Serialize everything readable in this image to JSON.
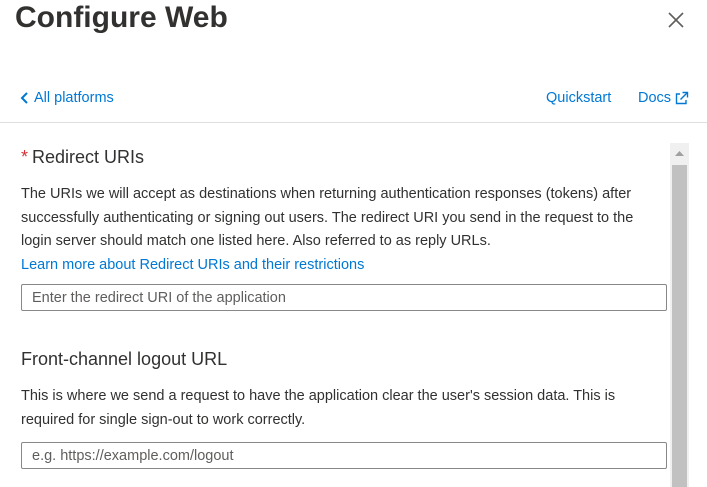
{
  "header": {
    "title": "Configure Web"
  },
  "nav": {
    "back_label": "All platforms",
    "quickstart_label": "Quickstart",
    "docs_label": "Docs"
  },
  "redirect": {
    "required_marker": "*",
    "heading": "Redirect URIs",
    "description": "The URIs we will accept as destinations when returning authentication responses (tokens) after successfully authenticating or signing out users. The redirect URI you send in the request to the login server should match one listed here. Also referred to as reply URLs.",
    "learn_more": "Learn more about Redirect URIs and their restrictions",
    "input_value": "",
    "input_placeholder": "Enter the redirect URI of the application"
  },
  "logout": {
    "heading": "Front-channel logout URL",
    "description": "This is where we send a request to have the application clear the user's session data. This is required for single sign-out to work correctly.",
    "input_value": "",
    "input_placeholder": "e.g. https://example.com/logout"
  },
  "icons": {
    "close": "close-icon",
    "back": "chevron-left-icon",
    "external": "external-link-icon",
    "scroll_up": "scroll-up-arrow-icon"
  },
  "colors": {
    "link": "#0078d4",
    "required": "#d13438",
    "text": "#323130",
    "divider": "#e1dfdd"
  }
}
